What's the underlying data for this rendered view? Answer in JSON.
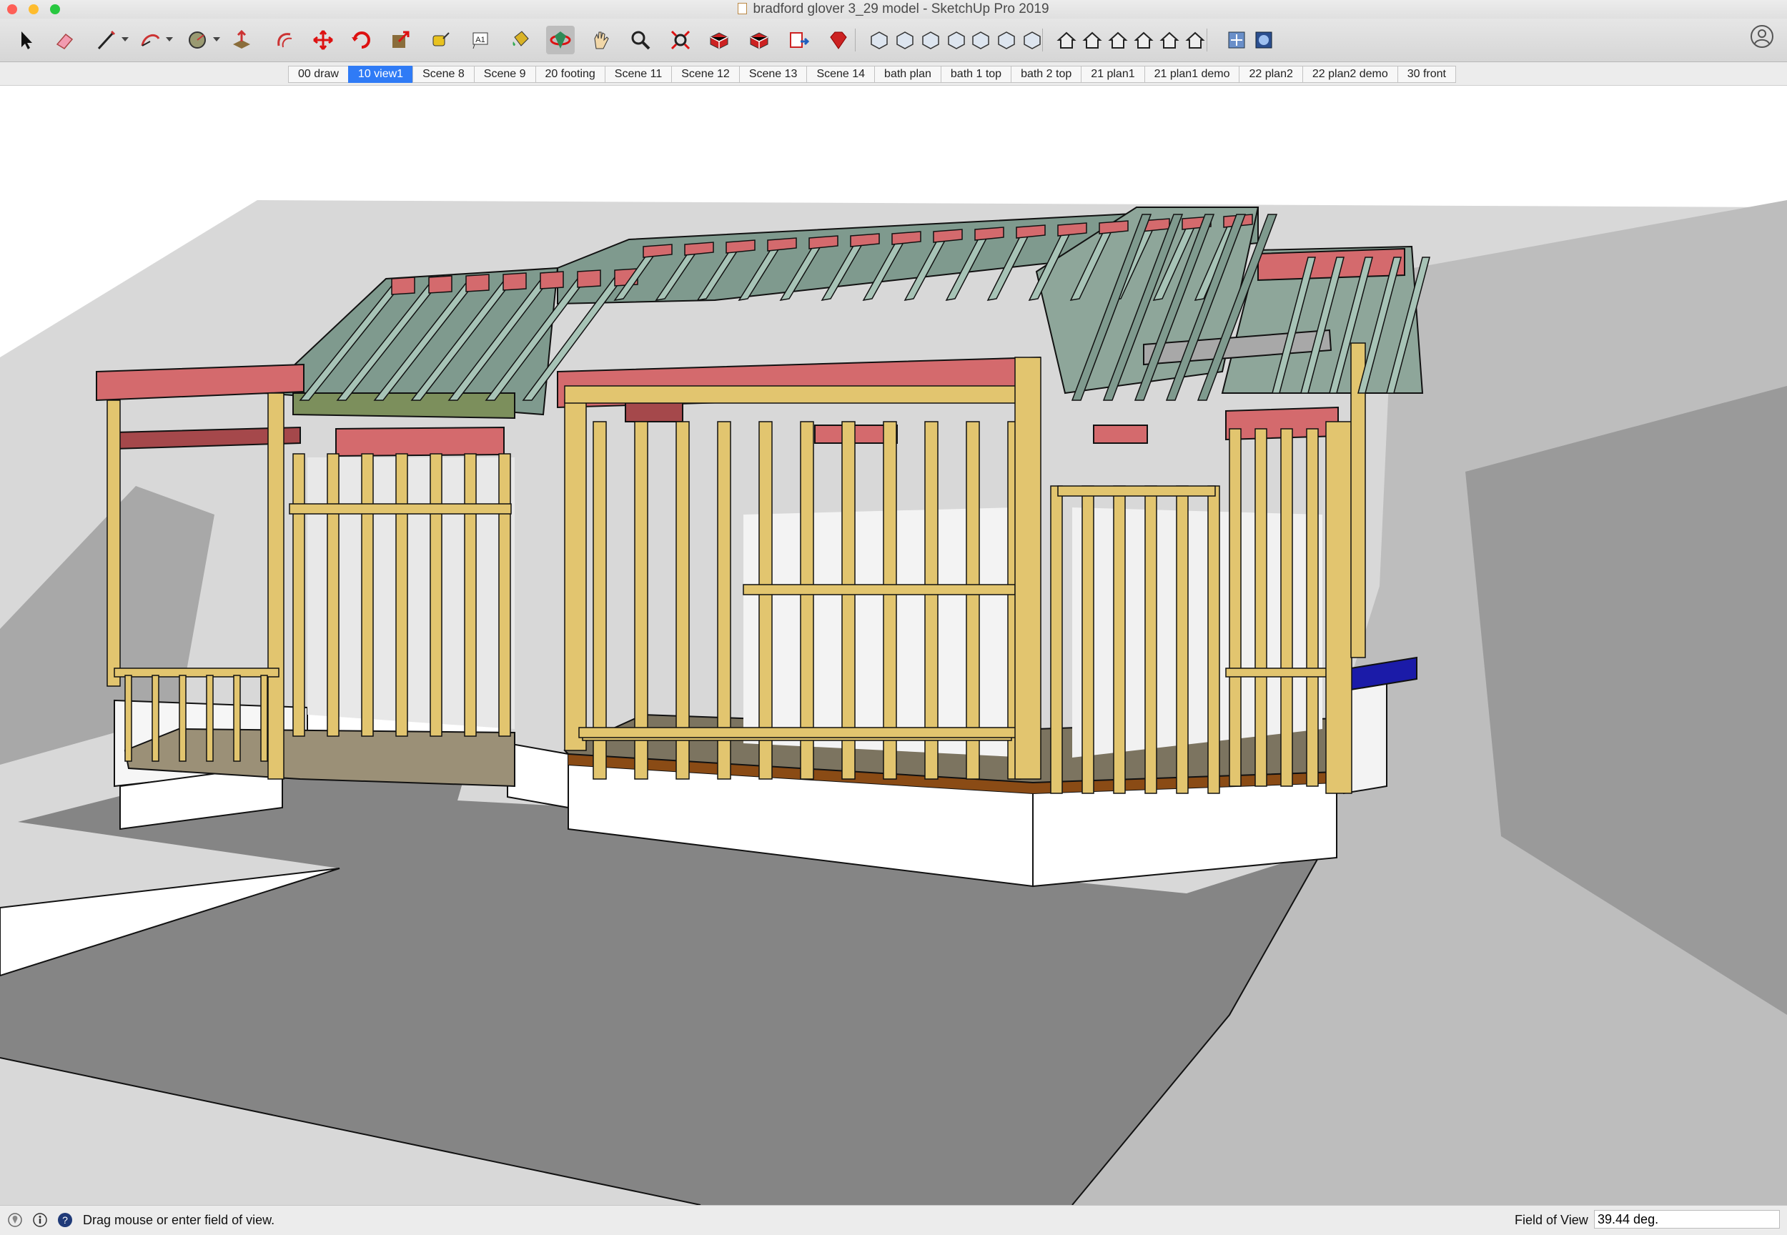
{
  "window": {
    "title": "bradford glover 3_29 model - SketchUp Pro 2019",
    "traffic_lights": [
      "#fe5f57",
      "#febc2e",
      "#28c840"
    ]
  },
  "toolbar": {
    "tools": [
      {
        "name": "select-tool-icon"
      },
      {
        "name": "eraser-tool-icon"
      },
      {
        "name": "line-tool-icon",
        "has_dropdown": true
      },
      {
        "name": "arc-tool-icon",
        "has_dropdown": true
      },
      {
        "name": "shape-tool-icon",
        "has_dropdown": true
      },
      {
        "name": "push-pull-tool-icon"
      },
      {
        "name": "offset-tool-icon"
      },
      {
        "name": "move-tool-icon"
      },
      {
        "name": "rotate-tool-icon"
      },
      {
        "name": "scale-tool-icon"
      },
      {
        "name": "tape-measure-tool-icon"
      },
      {
        "name": "text-tool-icon"
      },
      {
        "name": "paint-bucket-tool-icon"
      },
      {
        "name": "orbit-tool-icon",
        "active": true
      },
      {
        "name": "pan-tool-icon"
      },
      {
        "name": "zoom-tool-icon"
      },
      {
        "name": "zoom-extents-tool-icon"
      },
      {
        "name": "3d-warehouse-icon"
      },
      {
        "name": "extension-warehouse-icon"
      },
      {
        "name": "send-to-layout-icon"
      },
      {
        "name": "extension-manager-icon"
      },
      {
        "name": "xray-style-icon"
      },
      {
        "name": "back-edges-style-icon"
      },
      {
        "name": "wireframe-style-icon"
      },
      {
        "name": "hidden-line-style-icon"
      },
      {
        "name": "shaded-style-icon"
      },
      {
        "name": "shaded-textures-style-icon"
      },
      {
        "name": "monochrome-style-icon"
      },
      {
        "name": "iso-view-icon"
      },
      {
        "name": "top-view-icon"
      },
      {
        "name": "front-view-icon"
      },
      {
        "name": "right-view-icon"
      },
      {
        "name": "back-view-icon"
      },
      {
        "name": "left-view-icon"
      },
      {
        "name": "section-plane-icon"
      },
      {
        "name": "display-section-icon"
      }
    ]
  },
  "scenes": {
    "tabs": [
      "00 draw",
      "10 view1",
      "Scene 8",
      "Scene 9",
      "20 footing",
      "Scene 11",
      "Scene 12",
      "Scene 13",
      "Scene 14",
      "bath plan",
      "bath 1 top",
      "bath 2 top",
      "21 plan1",
      "21 plan1 demo",
      "22 plan2",
      "22 plan2 demo",
      "30 front"
    ],
    "active": "10 view1"
  },
  "viewport": {
    "colors": {
      "lumber": "#e2c56f",
      "lumber_shadow": "#b79b4c",
      "rafter": "#7f9a8e",
      "rafter_light": "#a7c3b6",
      "header": "#d46a6d",
      "header_dark": "#a5484b",
      "subfloor": "#7c7460",
      "sheathing": "#7c8f5c",
      "foundation": "#ffffff",
      "terrain_dark": "#7d7d7d",
      "terrain_light": "#dadada",
      "rim": "#8a4b15"
    }
  },
  "status": {
    "message": "Drag mouse or enter field of view.",
    "fov_label": "Field of View",
    "fov_value": "39.44 deg."
  }
}
